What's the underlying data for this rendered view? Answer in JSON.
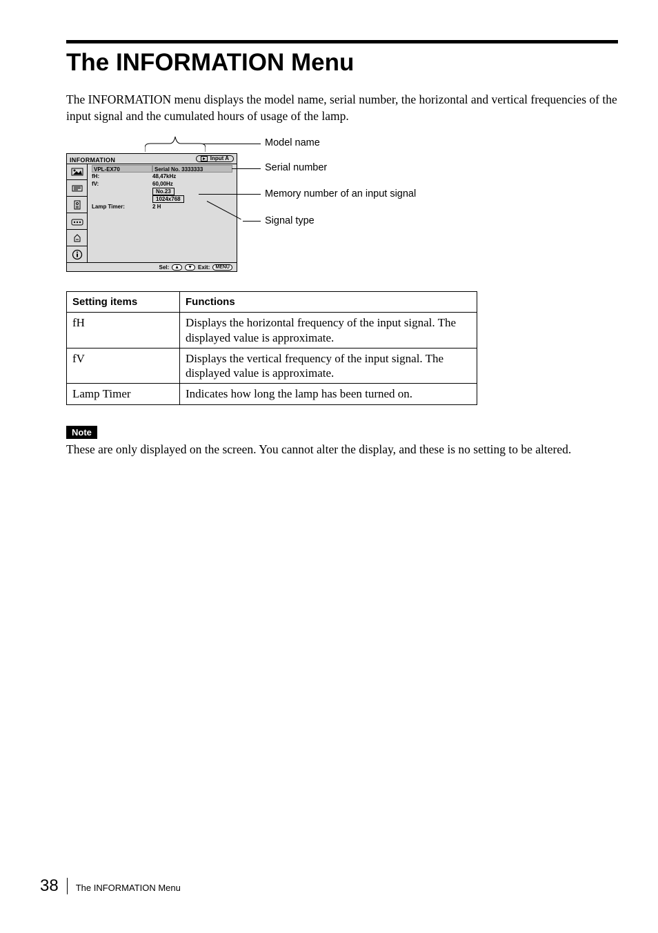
{
  "page": {
    "number": "38",
    "running_title": "The INFORMATION Menu"
  },
  "title": "The INFORMATION Menu",
  "intro": "The INFORMATION menu displays the model name, serial number, the horizontal and vertical frequencies of the input signal and the cumulated hours of usage of the lamp.",
  "osd": {
    "header": "INFORMATION",
    "input_pill": "Input A",
    "model": "VPL-EX70",
    "serial_label": "Serial No. 3333333",
    "fH_label": "fH:",
    "fH_value": "48,47kHz",
    "fV_label": "fV:",
    "fV_value": "60,00Hz",
    "mem_no": "No.23",
    "signal_type": "1024x768",
    "lamp_timer_label": "Lamp Timer:",
    "lamp_timer_value": "2     H",
    "status_sel": "Sel:",
    "status_exit": "Exit:",
    "status_menu": "MENU"
  },
  "labels": {
    "model_name": "Model name",
    "serial_number": "Serial number",
    "memory_number": "Memory number of an input signal",
    "signal_type": "Signal type"
  },
  "table": {
    "header_items": "Setting items",
    "header_functions": "Functions",
    "rows": [
      {
        "item": "fH",
        "func": "Displays the horizontal frequency of the input signal. The displayed value is approximate."
      },
      {
        "item": "fV",
        "func": "Displays the vertical frequency of the input signal. The displayed value is approximate."
      },
      {
        "item": "Lamp Timer",
        "func": "Indicates how long the lamp has been turned on."
      }
    ]
  },
  "note": {
    "badge": "Note",
    "text": "These are only displayed on the screen. You cannot alter the display, and these is no setting to be altered."
  }
}
